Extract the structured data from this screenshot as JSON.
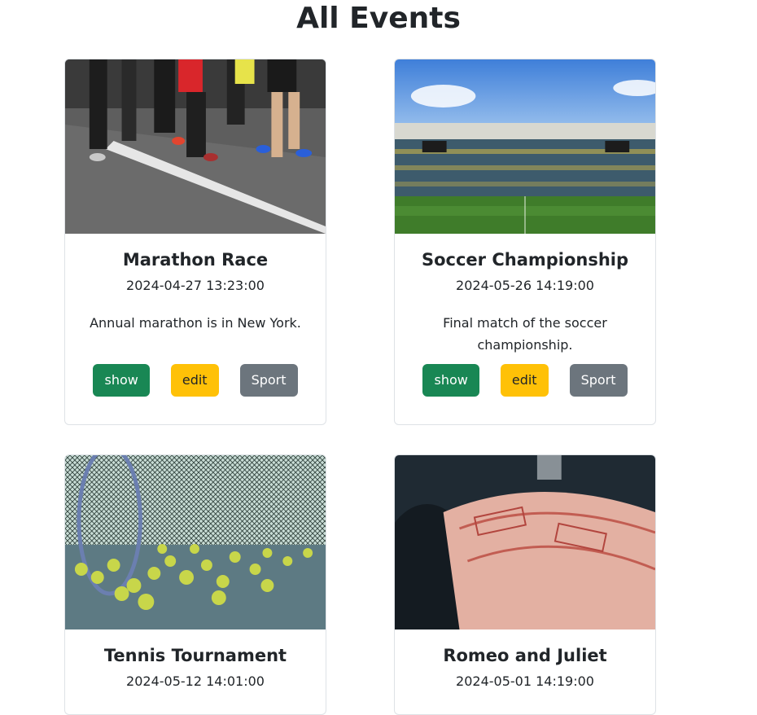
{
  "page": {
    "title": "All Events"
  },
  "events": [
    {
      "title": "Marathon Race",
      "datetime": "2024-04-27 13:23:00",
      "description": "Annual marathon is in New York.",
      "show_label": "show",
      "edit_label": "edit",
      "category_label": "Sport"
    },
    {
      "title": "Soccer Championship",
      "datetime": "2024-05-26 14:19:00",
      "description": "Final match of the soccer championship.",
      "show_label": "show",
      "edit_label": "edit",
      "category_label": "Sport"
    },
    {
      "title": "Tennis Tournament",
      "datetime": "2024-05-12 14:01:00"
    },
    {
      "title": "Romeo and Juliet",
      "datetime": "2024-05-01 14:19:00"
    }
  ],
  "colors": {
    "show": "#198754",
    "edit": "#ffc107",
    "category": "#6c757d",
    "text": "#212529",
    "border": "#dee2e6"
  },
  "images": [
    "marathon-runners-photo",
    "soccer-stadium-photo",
    "tennis-balls-net-photo",
    "theater-tickets-photo"
  ]
}
